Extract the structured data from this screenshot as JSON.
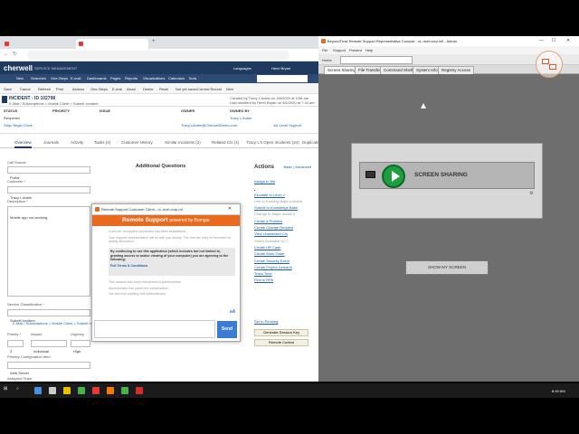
{
  "browser": {
    "tabs": [
      {
        "label": "Portal (not logged in) - IT Servic..."
      },
      {
        "label": "Incident 102798 - Cherwell Servi..."
      }
    ],
    "address": "Not secure | iser/Rev/CherwellClient/Access/?...740[0a4f4",
    "app_logo": "cherwell",
    "app_subtitle": "SERVICE MANAGEMENT",
    "nav": [
      "New",
      "Searches",
      "One-Steps",
      "E-mail",
      "Dashboards",
      "Pages",
      "Reports",
      "Visualizations",
      "Calendars",
      "Tools"
    ],
    "quick_search": "Quick Search",
    "languages": "Languages",
    "user": "Henri Bryan",
    "toolbar": [
      "Save",
      "Cancel",
      "Refresh",
      "Print",
      "Actions",
      "One-Steps",
      "E-mail",
      "About",
      "Delete",
      "Reset",
      "Current Record",
      "Next",
      "Not yet saved"
    ],
    "incident_title": "INCIDENT - ID 102798",
    "incident_sub": "E-Mail / Subscriptions > Mobile Client > Submit Incident",
    "created_by": "Created by Tracy L Aubin on 4/6/2020 at 9:58 am",
    "modified_by": "Last modified by Henri Bryan on 4/6/2020 at 7:44 am",
    "status_cols": [
      "STATUS",
      "PRIORITY",
      "ISSUE",
      "OWNER",
      "OWNED BY"
    ],
    "status_vals": [
      "Reopened",
      "",
      "",
      "",
      "Tracy L Aubin"
    ],
    "clock_link": "Stop/ Begin Clock",
    "owner_email": "Tracy.LAubin@CherwellDemo.com",
    "sla_link": "1st Level Support",
    "subtabs": [
      "Overview",
      "Journals",
      "Activity",
      "Tasks (4)",
      "Customer History",
      "Similar Incidents (2)",
      "Related CIs (1)",
      "Tracy L's Open Incidents (24)",
      "Duplicate"
    ],
    "form": {
      "call_source_label": "Call Source",
      "call_source": "Portal",
      "customer_label": "Customer *",
      "customer": "Tracy L Aubin",
      "description_label": "Description *",
      "description": "Mobile app not working.",
      "service_label": "Service Classification *",
      "service": "Submit Incident",
      "classification_link": "E-Mail / Subscriptions > Mobile Client > Submit Incident",
      "priority_label": "Priority *",
      "impact_label": "Impact",
      "urgency_label": "Urgency",
      "priority": "3",
      "impact": "Individual",
      "urgency": "High",
      "primary_ci_label": "Primary Configuration Item",
      "primary_ci": "Web Server",
      "team_label": "Assigned Team",
      "team": "1st Level Support",
      "assigned_to_label": "Assigned To",
      "assigned_to": "",
      "escalate_label": "Escalate",
      "additional_questions": "Additional Questions"
    },
    "actions": {
      "title": "Actions",
      "mode": "Basic | Advanced",
      "items": [
        {
          "label": "Assign to Me",
          "disabled": false
        },
        {
          "label": "",
          "disabled": false
        },
        {
          "label": "Escalate to Level 2",
          "disabled": false
        },
        {
          "label": "Link to Existing Major Incident",
          "disabled": true
        },
        {
          "label": "Submit to Knowledge Base",
          "disabled": false
        },
        {
          "label": "Change to Major Incident",
          "disabled": true
        },
        {
          "label": "Create a Problem",
          "disabled": false
        },
        {
          "label": "Create Change Request",
          "disabled": false
        },
        {
          "label": "View Unselected CIs",
          "disabled": false
        },
        {
          "label": "Select Available SCT",
          "disabled": true
        },
        {
          "label": "Create HR Case",
          "disabled": false
        },
        {
          "label": "Create Work Order",
          "disabled": false
        },
        {
          "label": "Create Security Event",
          "disabled": false
        },
        {
          "label": "Create Project Demand",
          "disabled": false
        },
        {
          "label": "Track Time",
          "disabled": false
        },
        {
          "label": "Find in RPA",
          "disabled": false
        }
      ],
      "set_pending": "Set to Pending",
      "generate_key": "Generate Session Key",
      "remote_control": "Remote Control"
    }
  },
  "chat": {
    "window_title": "Remote Support Customer Client - cL.rivet.corp.mil",
    "banner_main": "Remote Support",
    "banner_sub": "powered by Bomgar",
    "messages": [
      "A secure, encrypted connection has been established.",
      "Your support representative will be with you shortly. The rest can may be recorded for quality assurance.",
      "By continuing to use this application (which includes but not limited to, granting access to and/or viewing of your computer) you are agreeing to the following:",
      "Full Terms & Conditions",
      "This session has been transferred to Administrator.",
      "Administrator has joined the conversation.",
      "You are now chatting with Administrator."
    ],
    "input_placeholder": "",
    "send_label": "Send",
    "font_label": "aA"
  },
  "console": {
    "window_title": "BeyondTrust Remote Support Representative Console - cL.rivet.corp.mil - Admin",
    "menu": [
      "File",
      "Support",
      "Present",
      "Help"
    ],
    "bar2_home": "Home",
    "bar2_session": "Michael Durrant @ WIN11WM",
    "tabs": [
      "Screen Sharing",
      "File Transfer",
      "Command Shell",
      "System Info",
      "Registry Access"
    ],
    "screen_sharing_label": "SCREEN SHARING",
    "show_screen_label": "SHOW MY SCREEN"
  },
  "taskbar": {
    "icon_colors": [
      "#4a90d9",
      "#cccccc",
      "#e6c200",
      "#4caf50",
      "#e53935",
      "#f57c00",
      "#4caf50",
      "#d32f2f"
    ],
    "tray_time": "8:49 AM"
  }
}
